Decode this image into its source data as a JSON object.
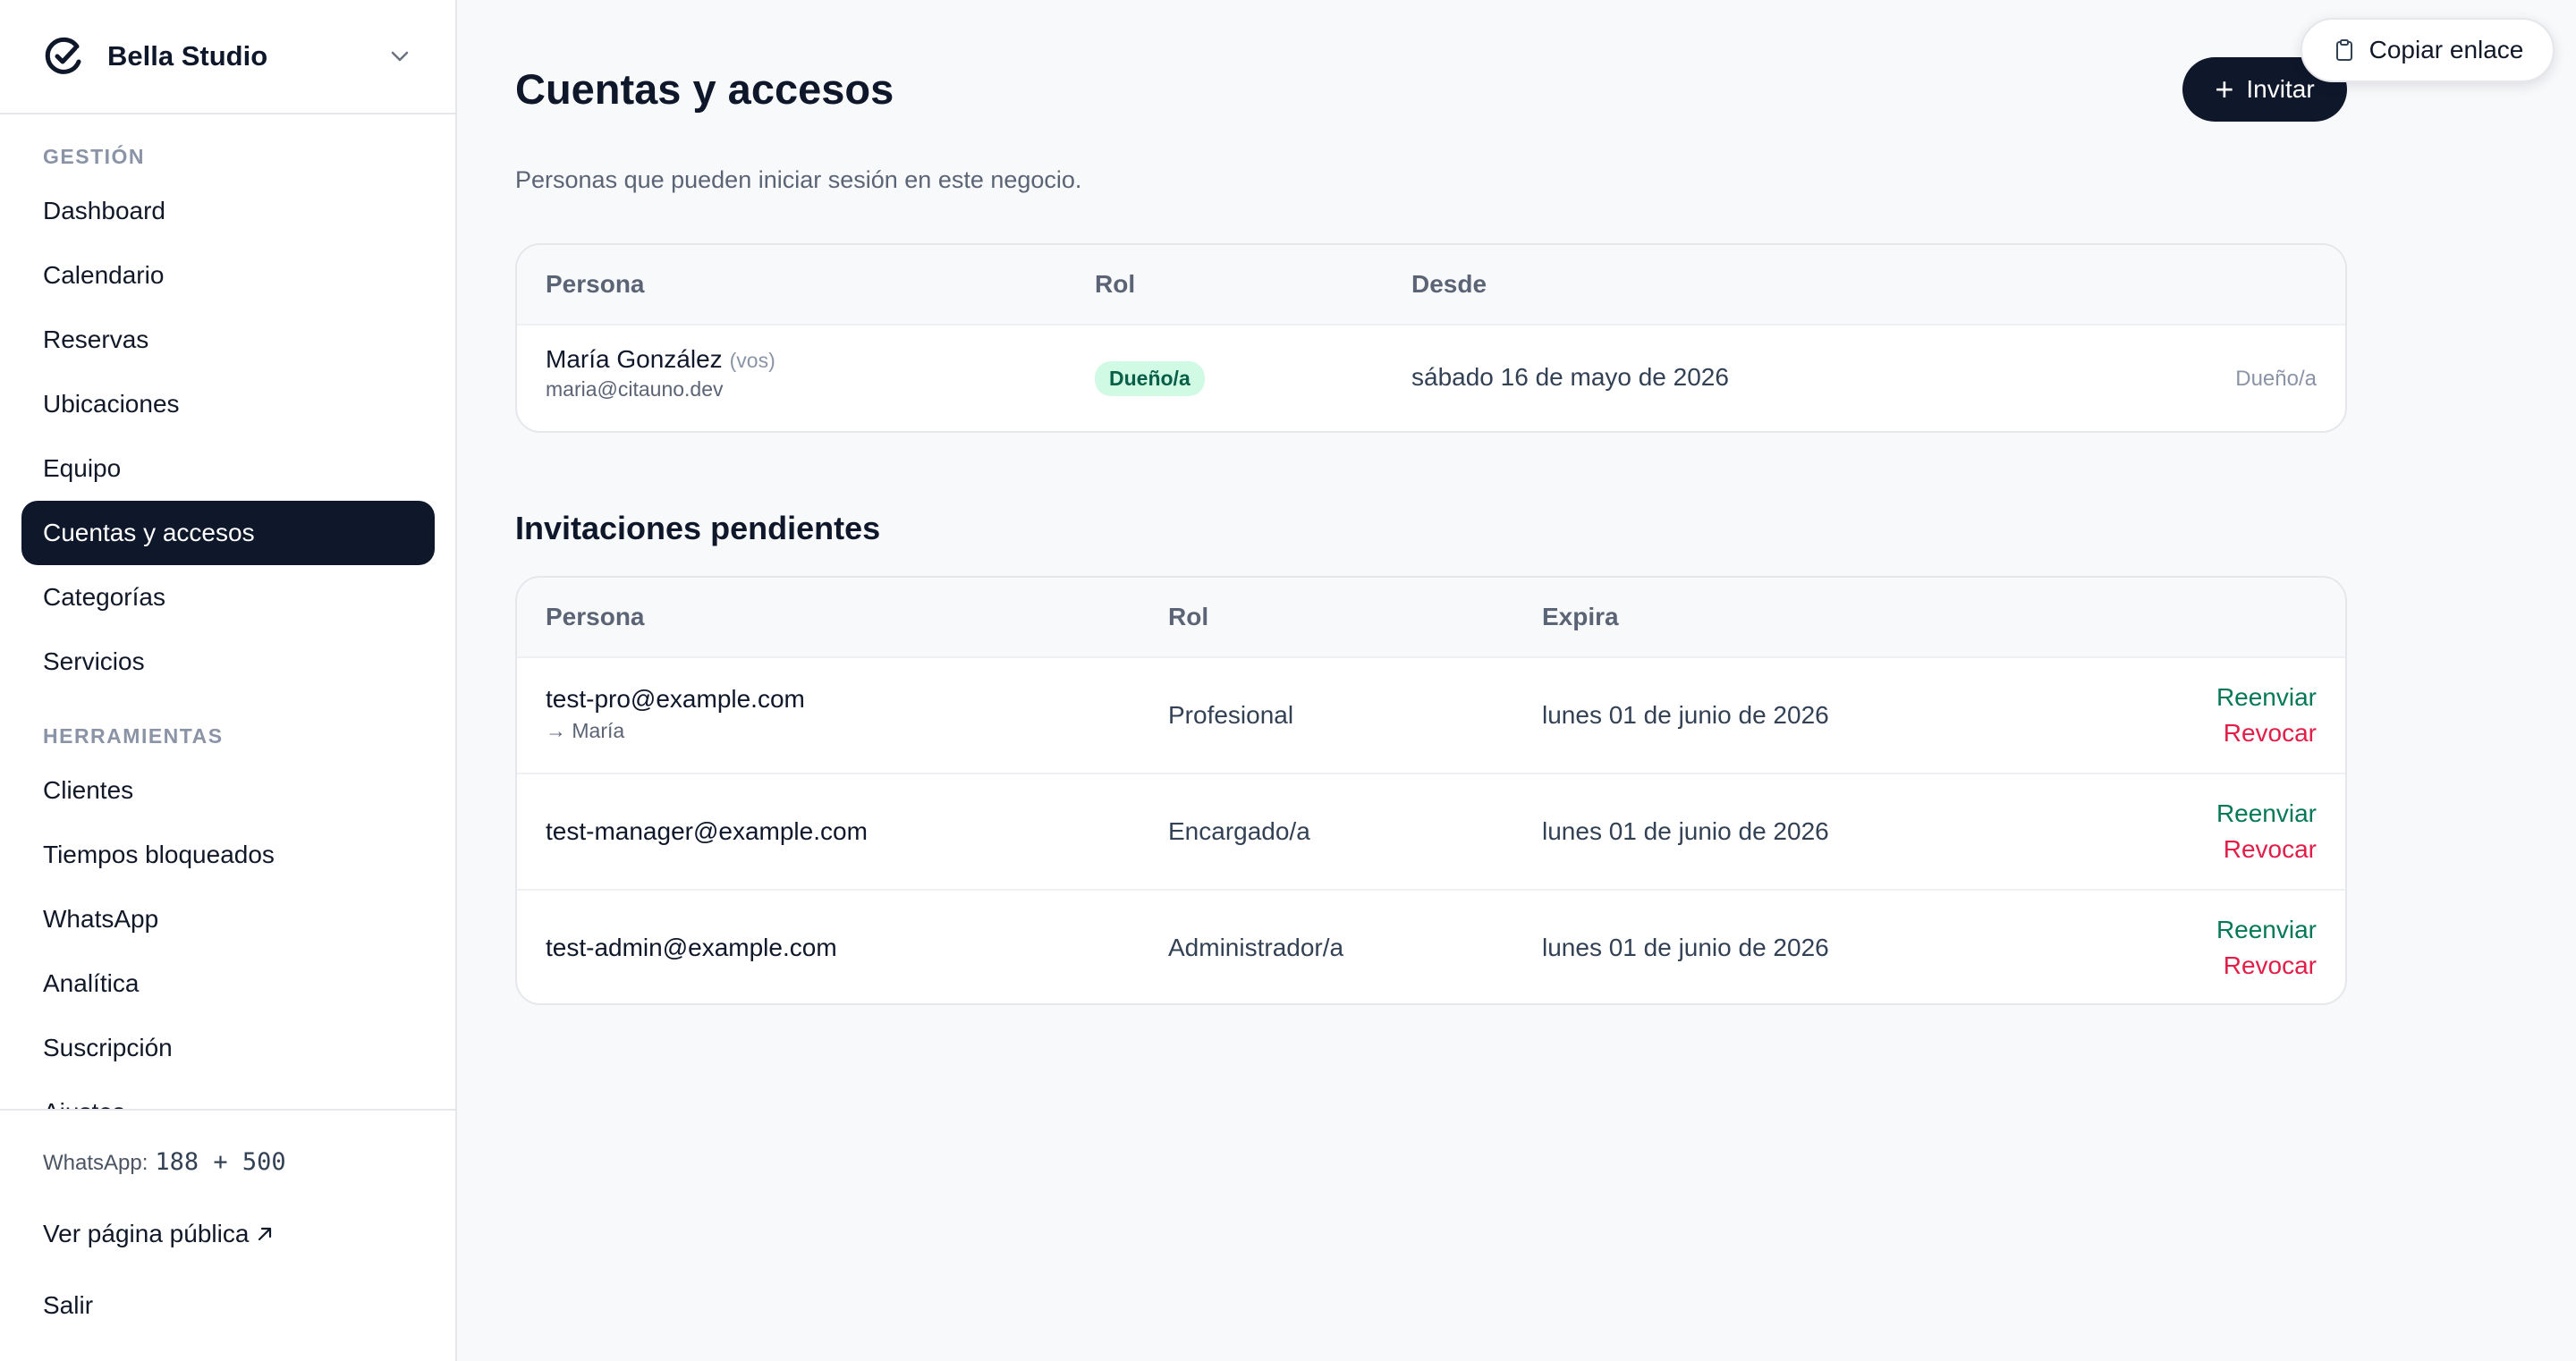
{
  "brand": {
    "name": "Bella Studio"
  },
  "nav": {
    "section_gestion": "GESTIÓN",
    "section_herramientas": "HERRAMIENTAS",
    "items": [
      {
        "label": "Dashboard"
      },
      {
        "label": "Calendario"
      },
      {
        "label": "Reservas"
      },
      {
        "label": "Ubicaciones"
      },
      {
        "label": "Equipo"
      },
      {
        "label": "Cuentas y accesos",
        "active": true
      },
      {
        "label": "Categorías"
      },
      {
        "label": "Servicios"
      },
      {
        "label": "Clientes"
      },
      {
        "label": "Tiempos bloqueados"
      },
      {
        "label": "WhatsApp"
      },
      {
        "label": "Analítica"
      },
      {
        "label": "Suscripción"
      },
      {
        "label": "Ajustes"
      }
    ]
  },
  "footer": {
    "whatsapp_label": "WhatsApp:",
    "whatsapp_count": "188 + 500",
    "public_page": "Ver página pública",
    "logout": "Salir"
  },
  "header": {
    "title": "Cuentas y accesos",
    "subtitle": "Personas que pueden iniciar sesión en este negocio.",
    "invite_label": "Invitar",
    "copy_link_label": "Copiar enlace"
  },
  "accounts": {
    "columns": [
      "Persona",
      "Rol",
      "Desde"
    ],
    "rows": [
      {
        "name": "María González",
        "you_tag": "(vos)",
        "email": "maria@citauno.dev",
        "role": "Dueño/a",
        "since": "sábado 16 de mayo de 2026",
        "right_tag": "Dueño/a"
      }
    ]
  },
  "pending": {
    "title": "Invitaciones pendientes",
    "columns": [
      "Persona",
      "Rol",
      "Expira"
    ],
    "resend_label": "Reenviar",
    "revoke_label": "Revocar",
    "rows": [
      {
        "email": "test-pro@example.com",
        "target": "→ María",
        "role": "Profesional",
        "expires": "lunes 01 de junio de 2026"
      },
      {
        "email": "test-manager@example.com",
        "role": "Encargado/a",
        "expires": "lunes 01 de junio de 2026"
      },
      {
        "email": "test-admin@example.com",
        "role": "Administrador/a",
        "expires": "lunes 01 de junio de 2026"
      }
    ]
  },
  "colors": {
    "primary": "#0f172a",
    "resend": "#047857",
    "revoke": "#e11d48",
    "badge_bg": "#d1fae5"
  }
}
